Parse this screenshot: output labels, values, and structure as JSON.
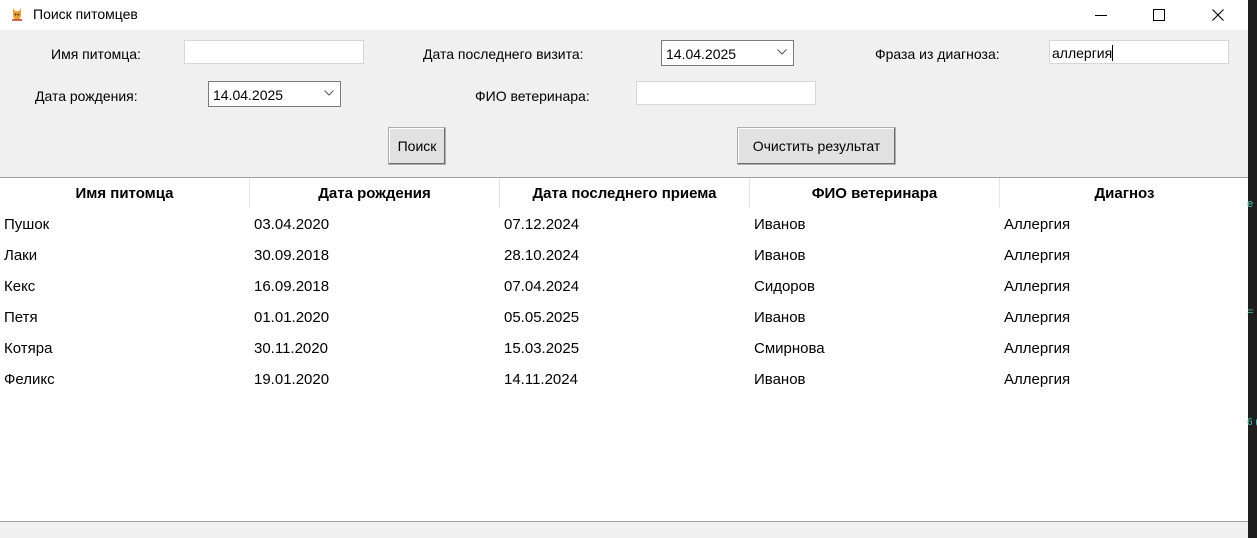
{
  "window": {
    "title": "Поиск питомцев",
    "controls": {
      "minimize": "minimize-icon",
      "maximize": "maximize-icon",
      "close": "close-icon"
    }
  },
  "form": {
    "pet_name_label": "Имя питомца:",
    "pet_name_value": "",
    "last_visit_label": "Дата последнего визита:",
    "last_visit_value": "14.04.2025",
    "diagnosis_label": "Фраза из диагноза:",
    "diagnosis_value": "аллергия",
    "birth_date_label": "Дата рождения:",
    "birth_date_value": "14.04.2025",
    "vet_label": "ФИО ветеринара:",
    "vet_value": ""
  },
  "buttons": {
    "search": "Поиск",
    "clear": "Очистить результат"
  },
  "table": {
    "columns": [
      "Имя питомца",
      "Дата рождения",
      "Дата последнего приема",
      "ФИО ветеринара",
      "Диагноз"
    ],
    "rows": [
      [
        "Пушок",
        "03.04.2020",
        "07.12.2024",
        "Иванов",
        "Аллергия"
      ],
      [
        "Лаки",
        "30.09.2018",
        "28.10.2024",
        "Иванов",
        "Аллергия"
      ],
      [
        "Кекс",
        "16.09.2018",
        "07.04.2024",
        "Сидоров",
        "Аллергия"
      ],
      [
        "Петя",
        "01.01.2020",
        "05.05.2025",
        "Иванов",
        "Аллергия"
      ],
      [
        "Котяра",
        "30.11.2020",
        "15.03.2025",
        "Смирнова",
        "Аллергия"
      ],
      [
        "Феликс",
        "19.01.2020",
        "14.11.2024",
        "Иванов",
        "Аллергия"
      ]
    ]
  },
  "background_fragments": [
    "e",
    "=",
    "6 ("
  ],
  "colors": {
    "editor_background": "#1e1e1e",
    "editor_text": "#4ec9b0",
    "window_background": "#f0f0f0"
  }
}
